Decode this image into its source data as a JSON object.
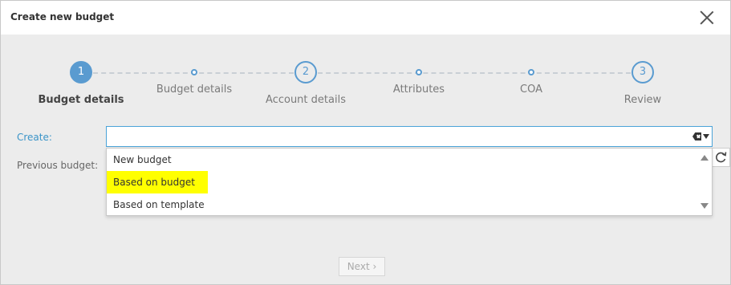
{
  "dialog": {
    "title": "Create new budget"
  },
  "steps": [
    {
      "label": "Budget details",
      "number": "1",
      "active": true,
      "kind": "major"
    },
    {
      "label": "Budget details",
      "kind": "minor"
    },
    {
      "label": "Account details",
      "number": "2",
      "kind": "major"
    },
    {
      "label": "Attributes",
      "kind": "minor"
    },
    {
      "label": "COA",
      "kind": "minor"
    },
    {
      "label": "Review",
      "number": "3",
      "kind": "major"
    }
  ],
  "form": {
    "create_label": "Create:",
    "create_value": "",
    "previous_budget_label": "Previous budget:",
    "options": [
      "New budget",
      "Based on budget",
      "Based on template"
    ],
    "highlighted_option": "Based on budget"
  },
  "footer": {
    "next_label": "Next ›"
  },
  "colors": {
    "accent": "#5a9bd0",
    "highlight": "#ffff00",
    "error": "#d9534f"
  }
}
